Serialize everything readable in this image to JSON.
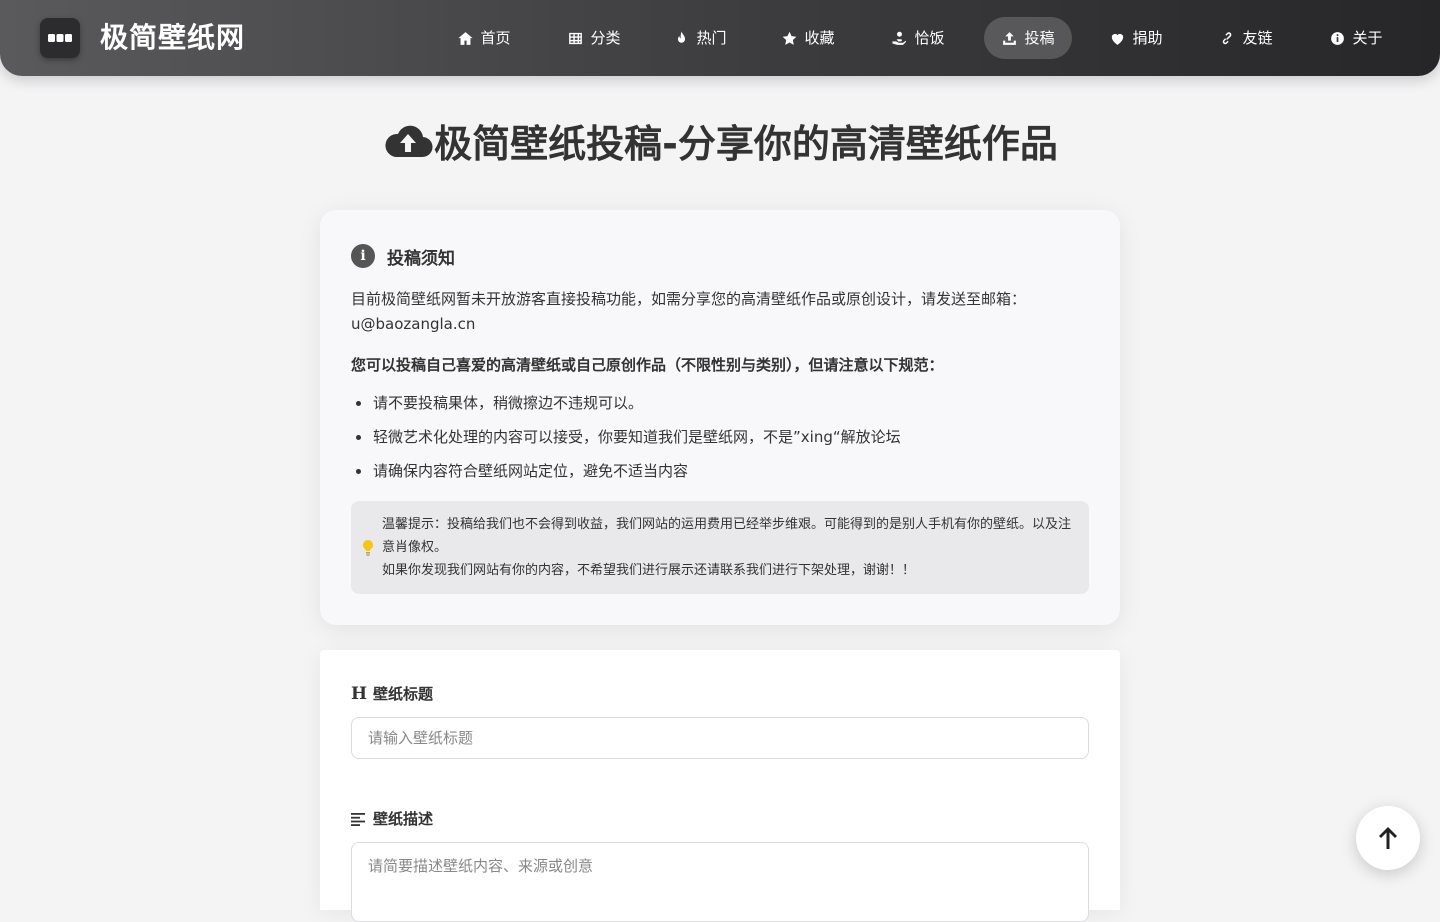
{
  "header": {
    "logo_text": "极简壁纸网",
    "nav": [
      {
        "label": "首页",
        "icon": "home-icon"
      },
      {
        "label": "分类",
        "icon": "grid-icon"
      },
      {
        "label": "热门",
        "icon": "fire-icon"
      },
      {
        "label": "收藏",
        "icon": "star-icon"
      },
      {
        "label": "恰饭",
        "icon": "hand-icon"
      },
      {
        "label": "投稿",
        "icon": "upload-icon",
        "active": true
      },
      {
        "label": "捐助",
        "icon": "heart-icon"
      },
      {
        "label": "友链",
        "icon": "link-icon"
      },
      {
        "label": "关于",
        "icon": "info-icon"
      }
    ]
  },
  "page": {
    "title": "极简壁纸投稿-分享你的高清壁纸作品"
  },
  "notice": {
    "heading": "投稿须知",
    "intro": "目前极简壁纸网暂未开放游客直接投稿功能，如需分享您的高清壁纸作品或原创设计，请发送至邮箱：",
    "email": "u@baozangla.cn",
    "rules_title": "您可以投稿自己喜爱的高清壁纸或自己原创作品（不限性别与类别），但请注意以下规范：",
    "rules": [
      "请不要投稿果体，稍微擦边不违规可以。",
      "轻微艺术化处理的内容可以接受，你要知道我们是壁纸网，不是”xing“解放论坛",
      "请确保内容符合壁纸网站定位，避免不适当内容"
    ],
    "tip_line1": "温馨提示：投稿给我们也不会得到收益，我们网站的运用费用已经举步维艰。可能得到的是别人手机有你的壁纸。以及注意肖像权。",
    "tip_line2": "如果你发现我们网站有你的内容，不希望我们进行展示还请联系我们进行下架处理，谢谢！！"
  },
  "form": {
    "title_label": "壁纸标题",
    "title_placeholder": "请输入壁纸标题",
    "desc_label": "壁纸描述",
    "desc_placeholder": "请简要描述壁纸内容、来源或创意"
  },
  "colors": {
    "header_start": "#5a5a5c",
    "header_end": "#262628",
    "page_bg": "#f4f4f5",
    "tip_bulb": "#f5c518"
  }
}
